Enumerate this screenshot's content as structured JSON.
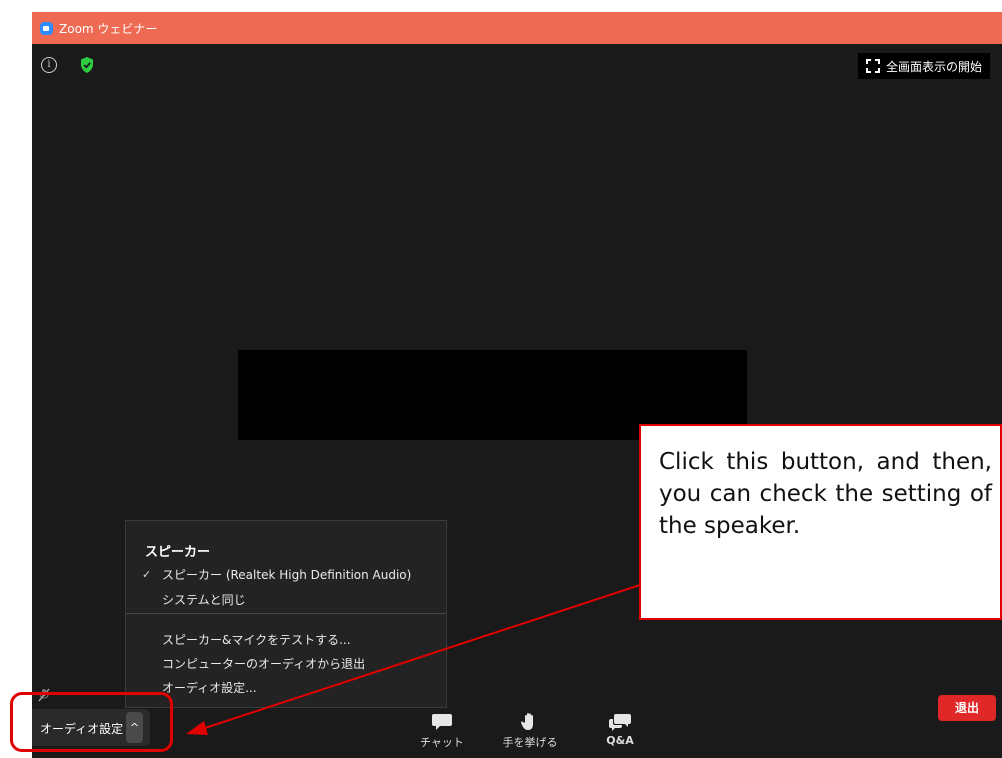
{
  "window": {
    "title": "Zoom ウェビナー"
  },
  "toolbar_top": {
    "fullscreen_label": "全画面表示の開始"
  },
  "audio_menu": {
    "header": "スピーカー",
    "items": [
      {
        "label": "スピーカー (Realtek High Definition Audio)",
        "checked": true
      },
      {
        "label": "システムと同じ",
        "checked": false
      },
      {
        "label": "スピーカー&マイクをテストする...",
        "checked": false
      },
      {
        "label": "コンピューターのオーディオから退出",
        "checked": false
      },
      {
        "label": "オーディオ設定...",
        "checked": false
      }
    ],
    "check_glyph": "✓"
  },
  "bottom_bar": {
    "audio_settings_label": "オーディオ設定",
    "caret_glyph": "^",
    "chat_label": "チャット",
    "raise_hand_label": "手を挙げる",
    "qa_label": "Q&A",
    "leave_label": "退出"
  },
  "annotation": {
    "callout_text": "Click this button, and then, you can check the setting of the speaker."
  },
  "colors": {
    "titlebar": "#ef6a52",
    "background": "#1a1a1a",
    "leave_button": "#e02828",
    "annotation_red": "#e00000",
    "security_green": "#2ecc40"
  },
  "icons": [
    "info-icon",
    "shield-check-icon",
    "fullscreen-icon",
    "mute-mic-icon",
    "chevron-up-icon",
    "chat-icon",
    "raise-hand-icon",
    "qa-icon"
  ]
}
